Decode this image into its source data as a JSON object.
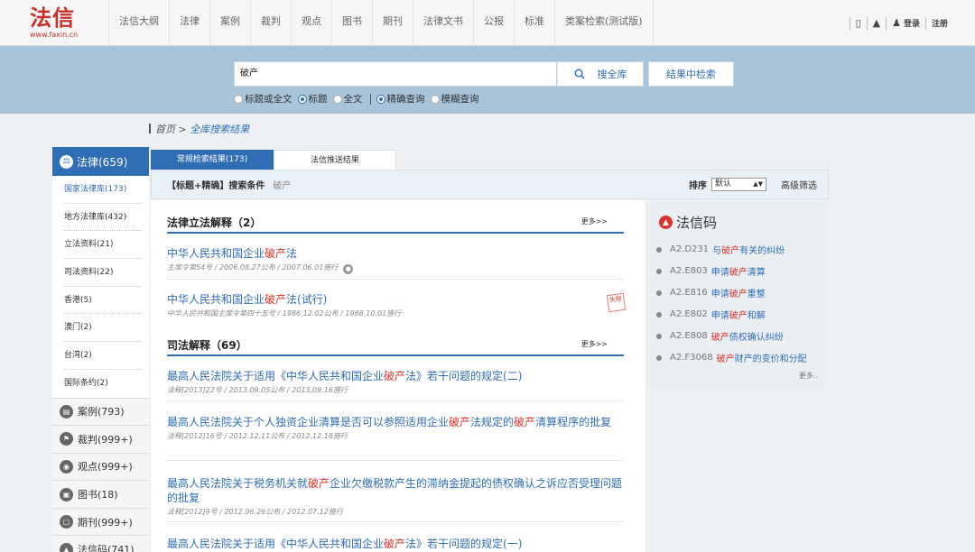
{
  "header": {
    "logo_text": "法信",
    "logo_url": "www.faxin.cn",
    "nav": [
      "法信大纲",
      "法律",
      "案例",
      "裁判",
      "观点",
      "图书",
      "期刊",
      "法律文书",
      "公报",
      "标准",
      "类案检索(测试版)"
    ],
    "login": "登录",
    "register": "注册"
  },
  "search": {
    "query": "破产",
    "search_all_label": "搜全库",
    "search_in_results_label": "结果中检索",
    "options": [
      {
        "label": "标题或全文",
        "checked": false
      },
      {
        "label": "标题",
        "checked": true
      },
      {
        "label": "全文",
        "checked": false
      },
      {
        "label": "精确查询",
        "checked": true
      },
      {
        "label": "模糊查询",
        "checked": false
      }
    ]
  },
  "breadcrumb": {
    "home": "首页",
    "sep": " > ",
    "current": "全库搜索结果"
  },
  "sidebar": {
    "head": "法律(659)",
    "subs": [
      "国家法律库(173)",
      "地方法律库(432)",
      "立法资料(21)",
      "司法资料(22)",
      "香港(5)",
      "澳门(2)",
      "台湾(2)",
      "国际条约(2)"
    ],
    "cats": [
      "案例(793)",
      "裁判(999+)",
      "观点(999+)",
      "图书(18)",
      "期刊(999+)",
      "法信码(741)"
    ]
  },
  "tabs": [
    "常规检索结果(173)",
    "法信推送结果"
  ],
  "conditions": {
    "label": "【标题+精确】搜索条件",
    "value": "破产",
    "sort_label": "排序",
    "sort_value": "默认",
    "advanced": "高级筛选"
  },
  "sections": [
    {
      "title": "法律立法解释（2）",
      "more": "更多>>"
    },
    {
      "title": "司法解释（69）",
      "more": "更多>>"
    }
  ],
  "results": [
    {
      "pre": "中华人民共和国企业",
      "hl": "破产",
      "post": "法",
      "meta": "主席令第54号 / 2006.08.27公布 / 2007.06.01施行"
    },
    {
      "pre": "中华人民共和国企业",
      "hl": "破产",
      "post": "法(试行)",
      "meta": "中华人民共和国主席令第四十五号 / 1986.12.02公布 / 1988.10.01施行",
      "stamp": "失效"
    },
    {
      "pre": "最高人民法院关于适用《中华人民共和国企业",
      "hl": "破产",
      "post": "法》若干问题的规定(二)",
      "meta": "法释[2013]22号 / 2013.09.05公布 / 2013.09.16施行"
    },
    {
      "pre": "最高人民法院关于个人独资企业清算是否可以参照适用企业",
      "hl": "破产",
      "mid": "法规定的",
      "hl2": "破产",
      "post": "清算程序的批复",
      "meta": "法释[2012]16号 / 2012.12.11公布 / 2012.12.18施行"
    },
    {
      "pre": "最高人民法院关于税务机关就",
      "hl": "破产",
      "post": "企业欠缴税款产生的滞纳金提起的债权确认之诉应否受理问题的批复",
      "meta": "法释[2012]9号 / 2012.06.26公布 / 2012.07.12施行"
    },
    {
      "pre": "最高人民法院关于适用《中华人民共和国企业",
      "hl": "破产",
      "post": "法》若干问题的规定(一)",
      "meta": ""
    }
  ],
  "faxin_code": {
    "title": "法信码",
    "items": [
      {
        "code": "A2.D231",
        "pre": "与",
        "hl": "破产",
        "post": "有关的纠纷"
      },
      {
        "code": "A2.E803",
        "pre": "申请",
        "hl": "破产",
        "post": "清算"
      },
      {
        "code": "A2.E816",
        "pre": "申请",
        "hl": "破产",
        "post": "重整"
      },
      {
        "code": "A2.E802",
        "pre": "申请",
        "hl": "破产",
        "post": "和解"
      },
      {
        "code": "A2.E808",
        "pre": "",
        "hl": "破产",
        "post": "债权确认纠纷"
      },
      {
        "code": "A2.F3068",
        "pre": "",
        "hl": "破产",
        "post": "财产的变价和分配"
      }
    ],
    "more": "更多.."
  },
  "colors": {
    "accent": "#2f6db4",
    "highlight": "#d9332b",
    "band": "#a8c4da"
  }
}
